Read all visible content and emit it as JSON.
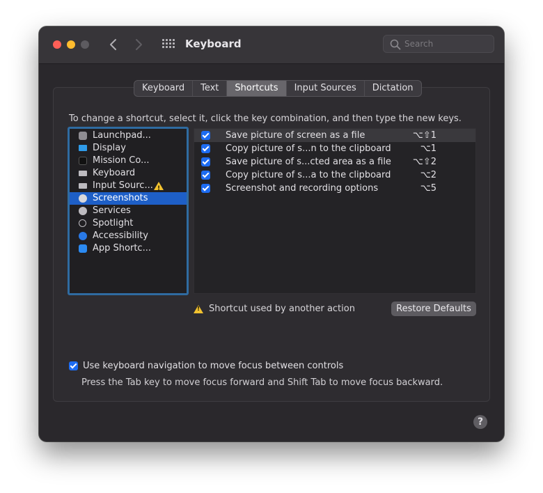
{
  "window": {
    "title": "Keyboard"
  },
  "search": {
    "placeholder": "Search",
    "icon": "magnifier-icon"
  },
  "tabs": [
    {
      "label": "Keyboard",
      "active": false
    },
    {
      "label": "Text",
      "active": false
    },
    {
      "label": "Shortcuts",
      "active": true
    },
    {
      "label": "Input Sources",
      "active": false
    },
    {
      "label": "Dictation",
      "active": false
    }
  ],
  "instructions": "To change a shortcut, select it, click the key combination, and then type the new keys.",
  "categories": [
    {
      "label": "Launchpad...",
      "icon": "launchpad-icon",
      "color": "#8e8c92"
    },
    {
      "label": "Display",
      "icon": "display-icon",
      "color": "#2f9be8"
    },
    {
      "label": "Mission Co...",
      "icon": "mission-control-icon",
      "color": "#111111"
    },
    {
      "label": "Keyboard",
      "icon": "keyboard-icon",
      "color": "#bdbbc0"
    },
    {
      "label": "Input Sourc...",
      "icon": "input-sources-icon",
      "color": "#bdbbc0",
      "warning": true
    },
    {
      "label": "Screenshots",
      "icon": "screenshots-icon",
      "color": "#d8d8dc",
      "selected": true
    },
    {
      "label": "Services",
      "icon": "gear-icon",
      "color": "#bdbbc0"
    },
    {
      "label": "Spotlight",
      "icon": "spotlight-icon",
      "color": "#4a484d"
    },
    {
      "label": "Accessibility",
      "icon": "accessibility-icon",
      "color": "#2979e6"
    },
    {
      "label": "App Shortc...",
      "icon": "app-store-icon",
      "color": "#2b8af2"
    }
  ],
  "shortcuts": [
    {
      "label": "Save picture of screen as a file",
      "keys": "⌥⇧1",
      "checked": true
    },
    {
      "label": "Copy picture of s...n to the clipboard",
      "keys": "⌥1",
      "checked": true
    },
    {
      "label": "Save picture of s...cted area as a file",
      "keys": "⌥⇧2",
      "checked": true
    },
    {
      "label": "Copy picture of s...a to the clipboard",
      "keys": "⌥2",
      "checked": true
    },
    {
      "label": "Screenshot and recording options",
      "keys": "⌥5",
      "checked": true
    }
  ],
  "legend": {
    "text": "Shortcut used by another action",
    "icon": "warning-icon"
  },
  "restore_label": "Restore Defaults",
  "keyboard_nav": {
    "label": "Use keyboard navigation to move focus between controls",
    "checked": true,
    "help": "Press the Tab key to move focus forward and Shift Tab to move focus backward."
  },
  "help_button": "?",
  "colors": {
    "accent": "#1d6cf2",
    "selection": "#1e5fc7",
    "warning": "#f2c230"
  }
}
